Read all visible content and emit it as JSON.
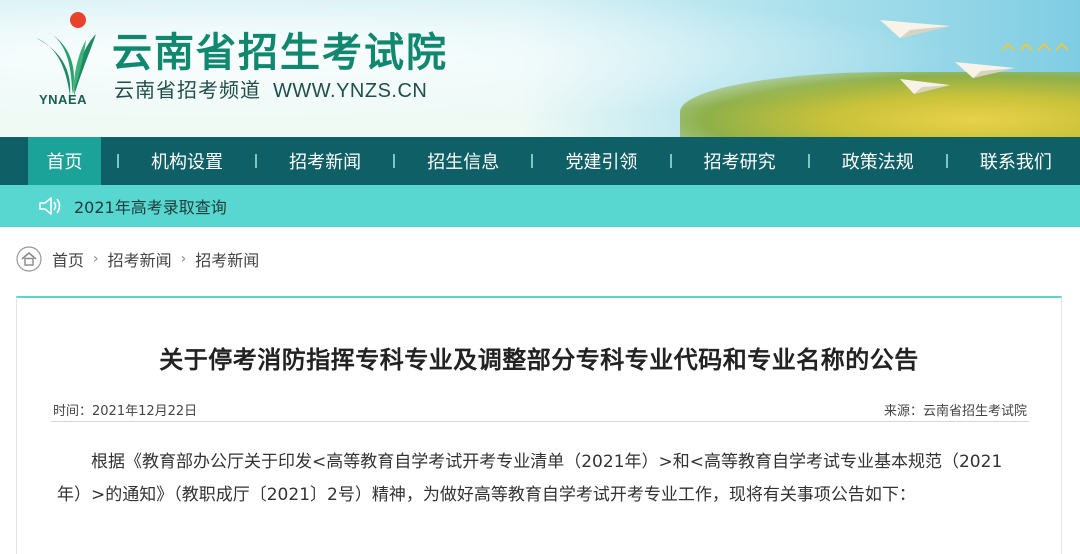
{
  "header": {
    "logo_text": "YNAEA",
    "site_title": "云南省招生考试院",
    "subtitle": "云南省招考频道",
    "url": "WWW.YNZS.CN"
  },
  "nav": {
    "items": [
      {
        "label": "首页",
        "active": true
      },
      {
        "label": "机构设置",
        "active": false
      },
      {
        "label": "招考新闻",
        "active": false
      },
      {
        "label": "招生信息",
        "active": false
      },
      {
        "label": "党建引领",
        "active": false
      },
      {
        "label": "招考研究",
        "active": false
      },
      {
        "label": "政策法规",
        "active": false
      },
      {
        "label": "联系我们",
        "active": false
      }
    ]
  },
  "notice": {
    "icon": "speaker-icon",
    "text": "2021年高考录取查询"
  },
  "breadcrumb": {
    "icon": "home-icon",
    "items": [
      "首页",
      "招考新闻",
      "招考新闻"
    ],
    "separator": "›"
  },
  "article": {
    "title": "关于停考消防指挥专科专业及调整部分专科专业代码和专业名称的公告",
    "time_label": "时间：2021年12月22日",
    "source_label": "来源：云南省招生考试院",
    "body": "根据《教育部办公厅关于印发<高等教育自学考试开考专业清单（2021年）>和<高等教育自学考试专业基本规范（2021年）>的通知》（教职成厅〔2021〕2号）精神，为做好高等教育自学考试开考专业工作，现将有关事项公告如下："
  },
  "colors": {
    "nav_bg": "#0f5f66",
    "nav_active": "#1ba39a",
    "notice_bg": "#58d6d0",
    "title_green": "#10886f"
  }
}
